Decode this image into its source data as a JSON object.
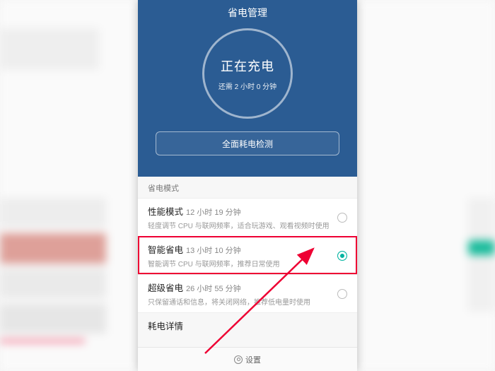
{
  "header": {
    "title": "省电管理"
  },
  "battery": {
    "status": "正在充电",
    "remaining": "还需 2 小时 0 分钟"
  },
  "detect_button": "全面耗电检测",
  "modes": {
    "section_label": "省电模式",
    "items": [
      {
        "name": "性能模式",
        "time": "12 小时 19 分钟",
        "desc": "轻度调节 CPU 与联网频率，适合玩游戏、观看视频时使用",
        "selected": false
      },
      {
        "name": "智能省电",
        "time": "13 小时 10 分钟",
        "desc": "智能调节 CPU 与联网频率，推荐日常使用",
        "selected": true
      },
      {
        "name": "超级省电",
        "time": "26 小时 55 分钟",
        "desc": "只保留通话和信息，将关闭网络，推荐低电量时使用",
        "selected": false
      }
    ]
  },
  "consumption_row": "耗电详情",
  "footer": {
    "label": "设置"
  }
}
